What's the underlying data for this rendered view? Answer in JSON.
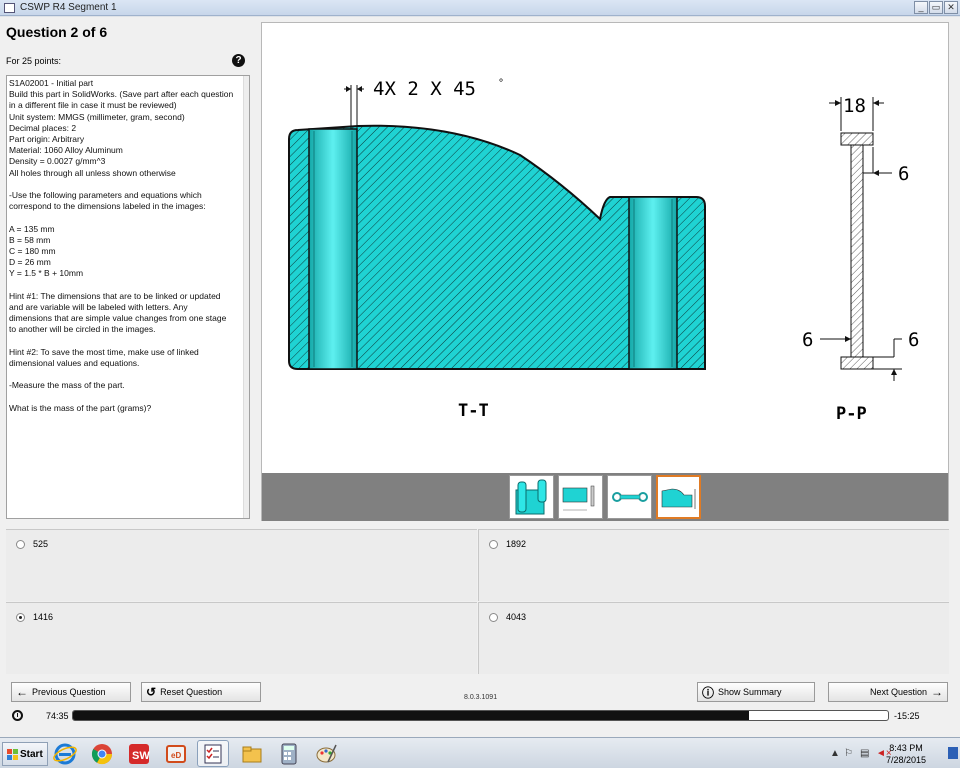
{
  "window": {
    "title": "CSWP R4 Segment 1",
    "controls": [
      "_",
      "▭",
      "✕"
    ]
  },
  "question": {
    "title": "Question 2 of 6",
    "points": "For 25 points:",
    "help_icon": "question-circle-icon",
    "body_lines": [
      "S1A02001 - Initial part",
      "Build this part in SolidWorks. (Save part after each question",
      "in a different file in case it must be reviewed)",
      "Unit system: MMGS (millimeter, gram, second)",
      "Decimal places: 2",
      "Part origin: Arbitrary",
      "Material: 1060 Alloy Aluminum",
      "Density = 0.0027 g/mm^3",
      "All holes through all unless shown otherwise",
      "",
      "-Use the following parameters and equations which",
      "correspond to the dimensions labeled in the images:",
      "",
      "A = 135 mm",
      "B = 58 mm",
      "C = 180 mm",
      "D = 26 mm",
      "Y = 1.5 * B + 10mm",
      "",
      "Hint #1: The dimensions that are to be linked or updated",
      "and are variable will be labeled with letters. Any",
      "dimensions that are simple value changes from one stage",
      "to another will be circled in the images.",
      "",
      "Hint #2: To save the most time, make use of linked",
      "dimensional values and equations.",
      "",
      "-Measure the mass of the part.",
      "",
      "What is the mass of the part (grams)?"
    ]
  },
  "drawing": {
    "chamfer_note": "4X  2 X 45",
    "chamfer_deg": "°",
    "section_left": "T-T",
    "section_right": "P-P",
    "dim_18": "18",
    "dim_6_right": "6",
    "dim_6_left": "6",
    "dim_6_bottom": "6",
    "fill_color": "#1fd3d3"
  },
  "thumbnails": [
    {
      "name": "thumb-3d-part",
      "active": false
    },
    {
      "name": "thumb-section-drawing",
      "active": false
    },
    {
      "name": "thumb-top-view",
      "active": false
    },
    {
      "name": "thumb-current-view",
      "active": true
    }
  ],
  "answers": [
    {
      "label": "525",
      "checked": false
    },
    {
      "label": "1892",
      "checked": false
    },
    {
      "label": "1416",
      "checked": true
    },
    {
      "label": "4043",
      "checked": false
    }
  ],
  "nav": {
    "previous": "Previous Question",
    "reset": "Reset Question",
    "summary": "Show Summary",
    "next": "Next Question",
    "version": "8.0.3.1091"
  },
  "timer": {
    "elapsed": "74:35",
    "remaining": "-15:25",
    "progress_fraction": 0.83
  },
  "taskbar": {
    "start": "Start",
    "time": "8:43 PM",
    "date": "7/28/2015"
  }
}
